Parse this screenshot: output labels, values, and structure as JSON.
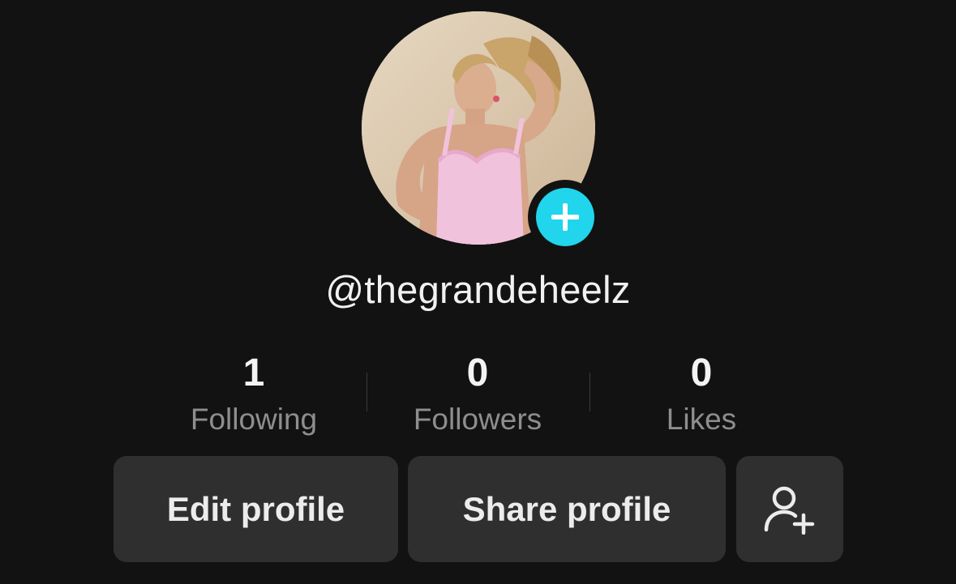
{
  "profile": {
    "username": "@thegrandeheelz",
    "avatar_description": "profile photo",
    "add_icon": "plus-icon"
  },
  "stats": [
    {
      "value": "1",
      "label": "Following"
    },
    {
      "value": "0",
      "label": "Followers"
    },
    {
      "value": "0",
      "label": "Likes"
    }
  ],
  "actions": {
    "edit_label": "Edit profile",
    "share_label": "Share profile",
    "add_friends_icon": "add-user-icon"
  },
  "colors": {
    "background": "#121212",
    "button": "#2f2f2f",
    "accent": "#20d5ec",
    "muted_text": "#8e8e8e"
  }
}
